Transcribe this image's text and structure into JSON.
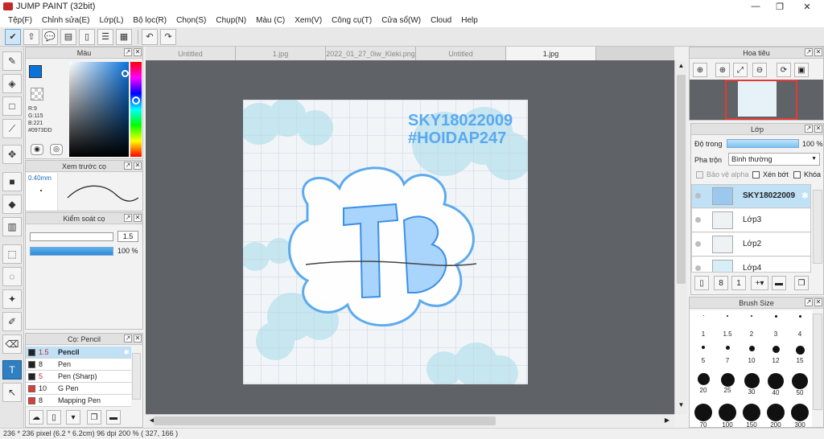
{
  "window": {
    "title": "JUMP PAINT (32bit)",
    "minimize": "—",
    "maximize": "❐",
    "close": "✕"
  },
  "menu": [
    "Tệp(F)",
    "Chỉnh sửa(E)",
    "Lớp(L)",
    "Bộ lọc(R)",
    "Chọn(S)",
    "Chụp(N)",
    "Màu (C)",
    "Xem(V)",
    "Công cụ(T)",
    "Cửa sổ(W)",
    "Cloud",
    "Help"
  ],
  "tabs": [
    "Untitled",
    "1.jpg",
    "2022_01_27_0iw_Kleki.png",
    "Untitled",
    "1.jpg"
  ],
  "color_panel": {
    "title": "Màu",
    "r": "R:9",
    "g": "G:115",
    "b": "B:221",
    "hex": "#0973DD",
    "color": "#0973dd"
  },
  "preview_panel": {
    "title": "Xem trước cọ",
    "size": "0.40mm"
  },
  "control_panel": {
    "title": "Kiểm soát cọ",
    "size_value": "1.5",
    "opacity_value": "100 %"
  },
  "brush_panel": {
    "title": "Cọ: Pencil",
    "items": [
      {
        "size": "1.5",
        "name": "Pencil",
        "color": "#222222"
      },
      {
        "size": "8",
        "name": "Pen",
        "color": "#222222"
      },
      {
        "size": "5",
        "name": "Pen (Sharp)",
        "color": "#222222"
      },
      {
        "size": "10",
        "name": "G Pen",
        "color": "#e53935"
      },
      {
        "size": "8",
        "name": "Mapping Pen",
        "color": "#e53935"
      }
    ]
  },
  "canvas_art": {
    "line1": "SKY18022009",
    "line2": "#HOIDAP247",
    "logo": "TB"
  },
  "navigator": {
    "title": "Hoa tiêu"
  },
  "layer_panel": {
    "title": "Lớp",
    "opacity_label": "Độ trong",
    "opacity_value": "100 %",
    "blend_label": "Pha trộn",
    "blend_value": "Bình thường",
    "protect_alpha": "Bảo vệ alpha",
    "clipping": "Xén bớt",
    "lock": "Khóa",
    "layers": [
      "SKY18022009",
      "Lớp3",
      "Lớp2",
      "Lớp4"
    ]
  },
  "brush_size_panel": {
    "title": "Brush Size",
    "sizes": [
      "1",
      "1.5",
      "2",
      "3",
      "4",
      "5",
      "7",
      "10",
      "12",
      "15",
      "20",
      "25",
      "30",
      "40",
      "50",
      "70",
      "100",
      "150",
      "200",
      "300"
    ]
  },
  "status": "236 * 236 pixel   (6.2 * 6.2cm)   96 dpi   200 %   ( 327, 166 )"
}
